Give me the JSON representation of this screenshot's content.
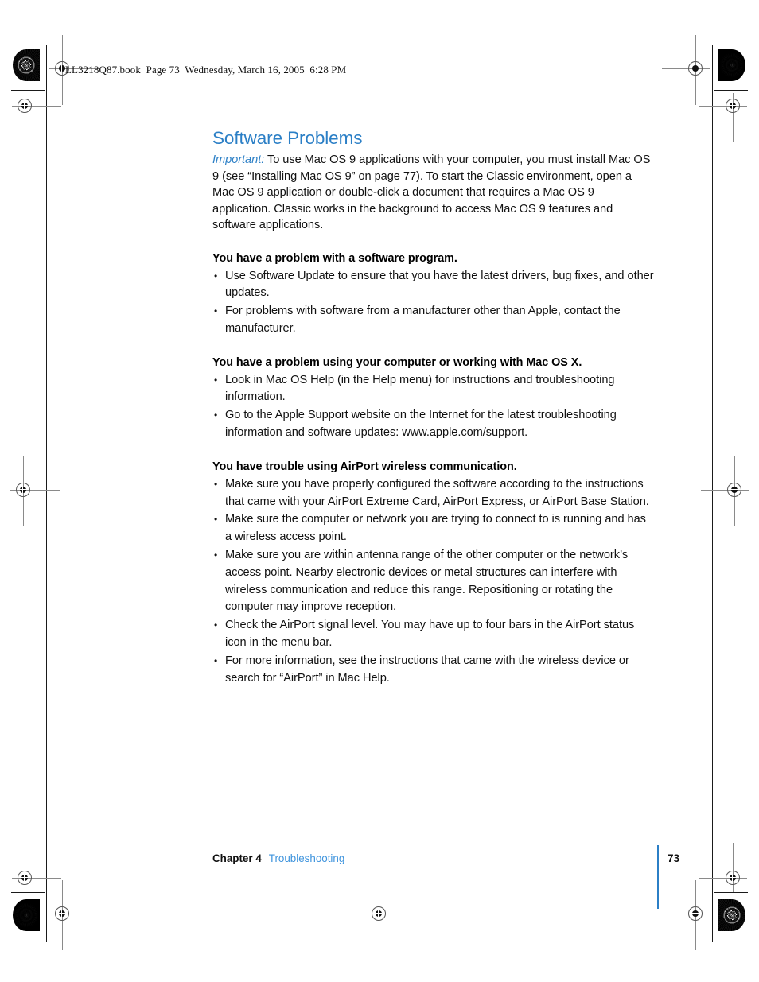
{
  "running_head": "LL3218Q87.book  Page 73  Wednesday, March 16, 2005  6:28 PM",
  "colors": {
    "heading_blue": "#2b7fc6",
    "link_blue": "#3f94dd",
    "body_black": "#111111"
  },
  "content": {
    "section_title": "Software Problems",
    "intro": {
      "lead": "Important:",
      "text": " To use Mac OS 9 applications with your computer, you must install Mac OS 9 (see “Installing Mac OS 9” on page 77). To start the Classic environment, open a Mac OS 9 application or double-click a document that requires a Mac OS 9 application. Classic works in the background to access Mac OS 9 features and software applications."
    },
    "sections": [
      {
        "heading": "You have a problem with a software program.",
        "bullets": [
          "Use Software Update to ensure that you have the latest drivers, bug fixes, and other updates.",
          "For problems with software from a manufacturer other than Apple, contact the manufacturer."
        ]
      },
      {
        "heading": "You have a problem using your computer or working with Mac OS X.",
        "bullets": [
          "Look in Mac OS Help (in the Help menu) for instructions and troubleshooting information.",
          "Go to the Apple Support website on the Internet for the latest troubleshooting information and software updates:  www.apple.com/support."
        ]
      },
      {
        "heading": "You have trouble using AirPort wireless communication.",
        "bullets": [
          "Make sure you have properly configured the software according to the instructions that came with your AirPort Extreme Card, AirPort Express, or AirPort Base Station.",
          "Make sure the computer or network you are trying to connect to is running and has a wireless access point.",
          "Make sure you are within antenna range of the other computer or the network’s access point. Nearby electronic devices or metal structures can interfere with wireless communication and reduce this range. Repositioning or rotating the computer may improve reception.",
          "Check the AirPort signal level. You may have up to four bars in the AirPort status icon in the menu bar.",
          "For more information, see the instructions that came with the wireless device or search for “AirPort” in Mac Help."
        ]
      }
    ]
  },
  "footer": {
    "chapter": "Chapter 4",
    "chapter_title": "Troubleshooting",
    "page_number": "73"
  }
}
